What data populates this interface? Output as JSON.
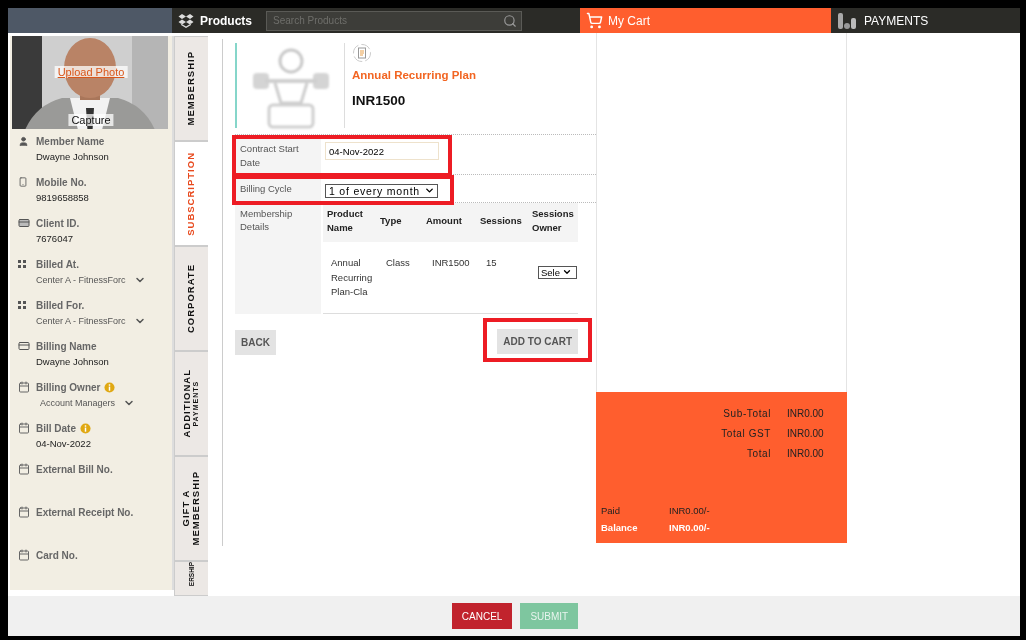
{
  "header": {
    "products_title": "Products",
    "search_placeholder": "Search Products",
    "cart_title": "My Cart",
    "payments_title": "PAYMENTS"
  },
  "sidebar": {
    "photo": {
      "upload_link": "Upload Photo",
      "capture": "Capture"
    },
    "fields": [
      {
        "label": "Member Name",
        "value": "Dwayne Johnson",
        "kind": "text",
        "info": false
      },
      {
        "label": "Mobile No.",
        "value": "9819658858",
        "kind": "text",
        "info": false
      },
      {
        "label": "Client ID.",
        "value": "7676047",
        "kind": "text",
        "info": false
      },
      {
        "label": "Billed At.",
        "value": "Center A - FitnessForc",
        "kind": "select",
        "info": false
      },
      {
        "label": "Billed For.",
        "value": "Center A - FitnessForc",
        "kind": "select",
        "info": false
      },
      {
        "label": "Billing Name",
        "value": "Dwayne  Johnson",
        "kind": "text",
        "info": false
      },
      {
        "label": "Billing Owner",
        "value": "Account Managers",
        "kind": "select",
        "info": true
      },
      {
        "label": "Bill Date",
        "value": "04-Nov-2022",
        "kind": "text",
        "info": true
      },
      {
        "label": "External Bill No.",
        "kind": "empty",
        "info": false
      },
      {
        "label": "External Receipt No.",
        "kind": "empty",
        "info": false
      },
      {
        "label": "Card No.",
        "kind": "empty",
        "info": false
      }
    ]
  },
  "tabs": [
    {
      "lines": [
        "MEMBERSHIP"
      ],
      "kind": "single",
      "selected": false
    },
    {
      "lines": [
        "SUBSCRIPTION"
      ],
      "kind": "single",
      "selected": true
    },
    {
      "lines": [
        "CORPORATE"
      ],
      "kind": "single",
      "selected": false
    },
    {
      "lines": [
        "ADDITIONAL",
        "PAYMENTS"
      ],
      "kind": "subtitle",
      "selected": false
    },
    {
      "lines": [
        "GIFT A",
        "MEMBERSHIP"
      ],
      "kind": "stacked",
      "selected": false
    },
    {
      "lines": [
        "ERSHIP"
      ],
      "kind": "cut",
      "selected": false
    }
  ],
  "product": {
    "title": "Annual Recurring Plan",
    "price": "INR1500"
  },
  "form": [
    {
      "label": "Contract Start Date",
      "kind": "input",
      "value": "04-Nov-2022",
      "highlighted": true
    },
    {
      "label": "Billing Cycle",
      "kind": "select",
      "value": "1 of every month",
      "highlighted": true
    }
  ],
  "membership_details": {
    "label": "Membership Details",
    "columns": [
      "Product Name",
      "Type",
      "Amount",
      "Sessions",
      "Sessions Owner"
    ],
    "rows": [
      {
        "product": "Annual Recurring Plan-Cla",
        "type": "Class",
        "amount": "INR1500",
        "sessions": "15",
        "owner": "Sele"
      }
    ]
  },
  "buttons": [
    {
      "label": "BACK",
      "kind": "back",
      "highlighted": false
    },
    {
      "label": "ADD TO CART",
      "kind": "add",
      "highlighted": true
    }
  ],
  "cart": {
    "totals": [
      {
        "label": "Sub-Total",
        "value": "INR0.00"
      },
      {
        "label": "Total GST",
        "value": "INR0.00"
      },
      {
        "label": "Total",
        "value": "INR0.00"
      }
    ],
    "balances": [
      {
        "label": "Paid",
        "value": "INR0.00/-"
      },
      {
        "label": "Balance",
        "value": "INR0.00/-"
      }
    ]
  },
  "footer_buttons": [
    {
      "label": "CANCEL",
      "kind": "cancel",
      "disabled": false
    },
    {
      "label": "SUBMIT",
      "kind": "submit",
      "disabled": true
    }
  ]
}
